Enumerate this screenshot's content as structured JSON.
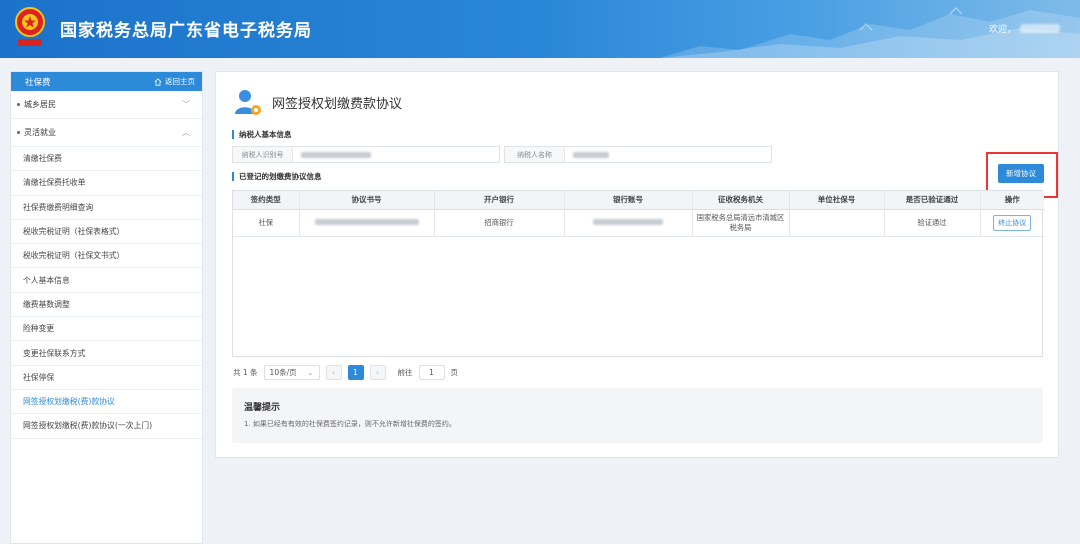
{
  "header": {
    "site_title": "国家税务总局广东省电子税务局",
    "welcome": "欢迎，"
  },
  "sidebar": {
    "title": "社保费",
    "home_label": "返回主页",
    "groups": [
      {
        "label": "城乡居民",
        "expanded": false
      },
      {
        "label": "灵活就业",
        "expanded": true
      }
    ],
    "items": [
      {
        "label": "清缴社保费"
      },
      {
        "label": "清缴社保费托收单"
      },
      {
        "label": "社保费缴费明细查询"
      },
      {
        "label": "税收完税证明（社保表格式）"
      },
      {
        "label": "税收完税证明（社保文书式）"
      },
      {
        "label": "个人基本信息"
      },
      {
        "label": "缴费基数调整"
      },
      {
        "label": "险种变更"
      },
      {
        "label": "变更社保联系方式"
      },
      {
        "label": "社保停保"
      },
      {
        "label": "网签授权划缴税(费)款协议",
        "active": true
      },
      {
        "label": "网签授权划缴税(费)款协议(一次上门)"
      }
    ]
  },
  "main": {
    "page_title": "网签授权划缴费款协议",
    "section_basic": "纳税人基本信息",
    "taxpayer_id_label": "纳税人识别号",
    "taxpayer_name_label": "纳税人名称",
    "section_registered": "已登记的划缴费协议信息",
    "add_button": "新增协议",
    "table": {
      "headers": [
        "签约类型",
        "协议书号",
        "开户银行",
        "银行账号",
        "征收税务机关",
        "单位社保号",
        "是否已验证通过",
        "操作"
      ],
      "rows": [
        {
          "type": "社保",
          "bank": "招商银行",
          "authority": "国家税务总局清远市清城区税务局",
          "unit_no": "",
          "verified": "验证通过",
          "action": "终止协议"
        }
      ]
    },
    "pager": {
      "total": "共 1 条",
      "page_size": "10条/页",
      "current": "1",
      "goto_prefix": "前往",
      "goto_value": "1",
      "goto_suffix": "页"
    },
    "tips": {
      "title": "温馨提示",
      "line1": "1. 如果已经有有效的社保费签约记录，则不允许新增社保费的签约。"
    }
  }
}
